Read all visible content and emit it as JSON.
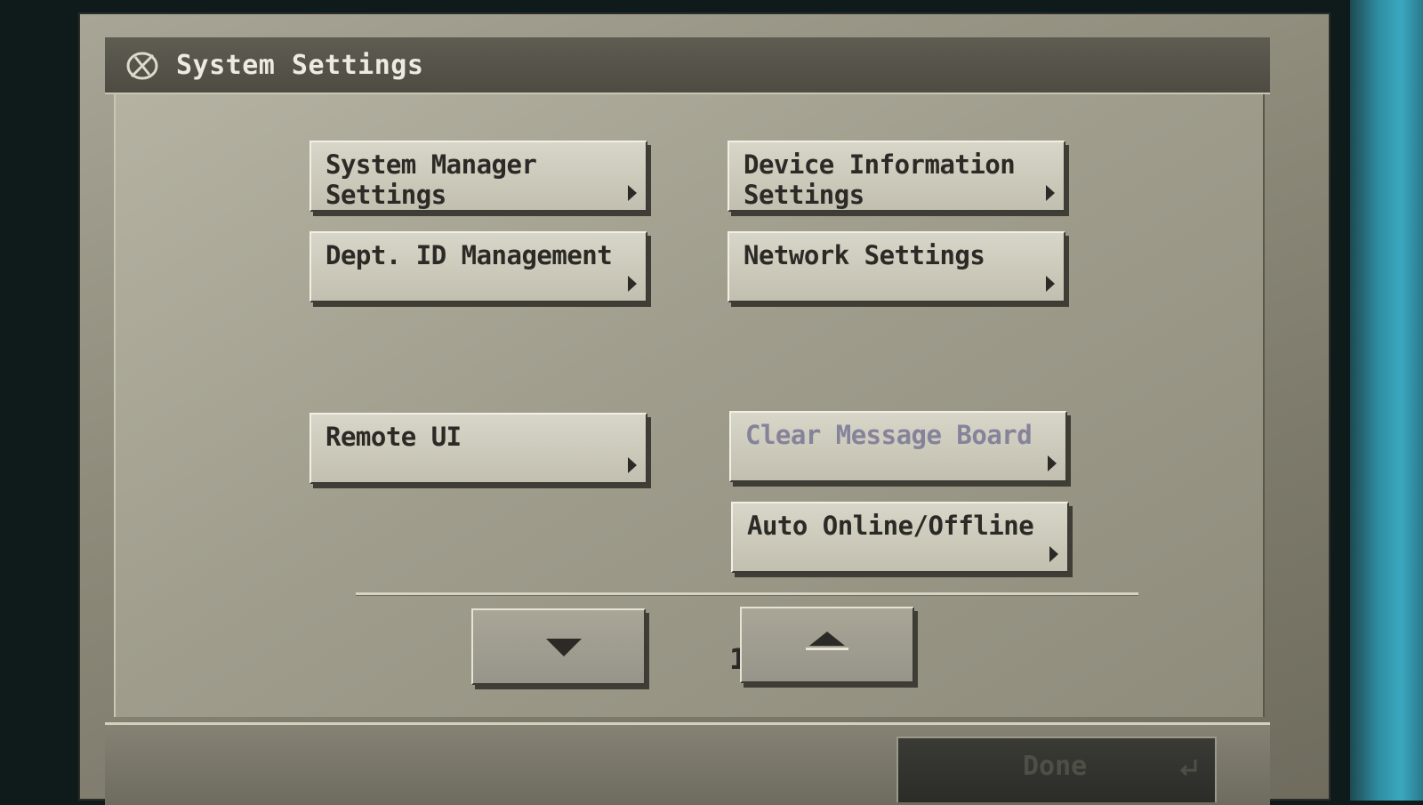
{
  "window": {
    "title": "System Settings",
    "title_icon": "wrench-gear-icon"
  },
  "menu": {
    "system_manager": {
      "label": "System Manager\nSettings",
      "enabled": true
    },
    "device_information": {
      "label": "Device Information\nSettings",
      "enabled": true
    },
    "dept_id": {
      "label": "Dept. ID Management",
      "enabled": true
    },
    "network": {
      "label": "Network Settings",
      "enabled": true
    },
    "remote_ui": {
      "label": "Remote UI",
      "enabled": true
    },
    "clear_message_board": {
      "label": "Clear Message Board",
      "enabled": false
    },
    "auto_online_offline": {
      "label": "Auto Online/Offline",
      "enabled": true
    }
  },
  "pagination": {
    "current": "1/4",
    "down_icon": "triangle-down-icon",
    "up_icon": "triangle-up-icon"
  },
  "footer": {
    "done_label": "Done",
    "done_icon": "enter-return-icon"
  },
  "colors": {
    "button_face": "#c9c6b6",
    "text": "#2b2a26",
    "disabled_text": "#85839a",
    "titlebar": "#4d4b42"
  }
}
